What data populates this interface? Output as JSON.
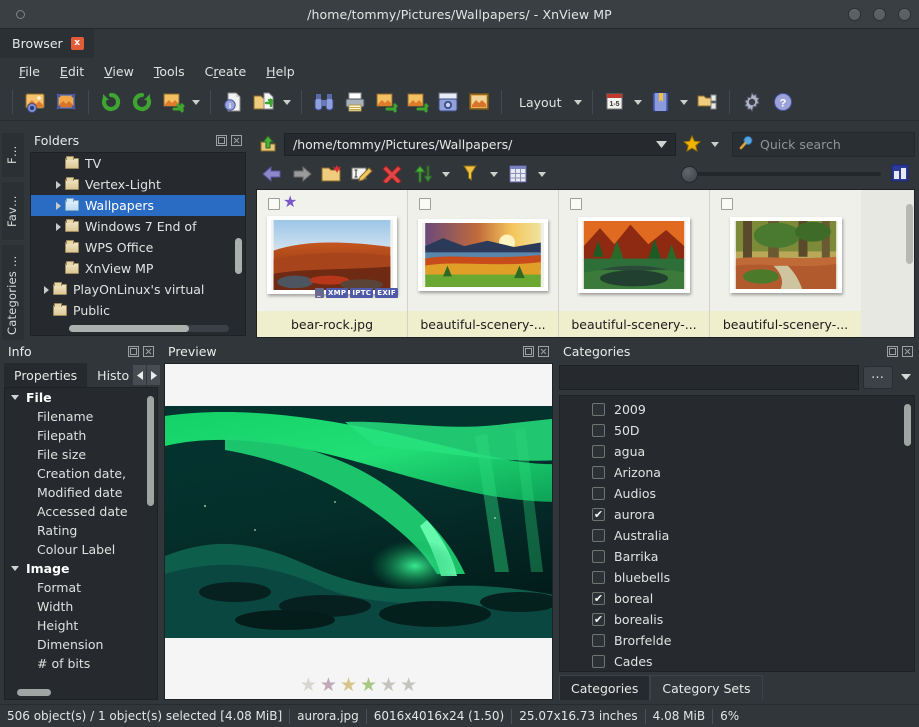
{
  "window": {
    "title": "/home/tommy/Pictures/Wallpapers/ - XnView MP",
    "controls": [
      "minimize",
      "maximize",
      "close"
    ]
  },
  "doc_tab": {
    "label": "Browser",
    "close_label": "x"
  },
  "menubar": [
    {
      "label": "File",
      "accel": "F"
    },
    {
      "label": "Edit",
      "accel": "E"
    },
    {
      "label": "View",
      "accel": "V"
    },
    {
      "label": "Tools",
      "accel": "T"
    },
    {
      "label": "Create",
      "accel": "r"
    },
    {
      "label": "Help",
      "accel": "H"
    }
  ],
  "toolbar": {
    "layout_label": "Layout",
    "buttons": [
      "open-image-icon",
      "fullscreen-icon",
      "rotate-left-icon",
      "rotate-right-icon",
      "convert-icon",
      "info-icon",
      "export-icon",
      "batch-rename-icon",
      "print-icon",
      "import-icon",
      "export-to-icon",
      "screen-capture-icon",
      "slideshow-icon",
      "numbered-pages-icon",
      "catalog-icon",
      "folder-compare-icon",
      "settings-gear-icon",
      "help-icon"
    ]
  },
  "browser": {
    "up_icon": "up-folder-icon",
    "address": "/home/tommy/Pictures/Wallpapers/",
    "favorites_icon": "star-icon",
    "search": {
      "placeholder": "Quick search",
      "icon": "search-icon",
      "value": ""
    },
    "subtoolbar": [
      "back-arrow-icon",
      "forward-arrow-icon",
      "new-folder-icon",
      "rename-icon",
      "delete-icon",
      "sort-icon",
      "filter-icon",
      "view-mode-icon"
    ],
    "zoom_slider_value": 0
  },
  "thumbnails": [
    {
      "filename": "bear-rock.jpg",
      "selected": true,
      "star": "★",
      "badges": [
        "XMP",
        "IPTC",
        "EXIF"
      ],
      "image_alt": "autumn-ridge-at-dusk"
    },
    {
      "filename": "beautiful-scenery-...",
      "selected": false,
      "star": "",
      "badges": [],
      "image_alt": "sunset-over-autumn-valley"
    },
    {
      "filename": "beautiful-scenery-...",
      "selected": false,
      "star": "",
      "badges": [],
      "image_alt": "red-forest-lake-reflection"
    },
    {
      "filename": "beautiful-scenery-...",
      "selected": false,
      "star": "",
      "badges": [],
      "image_alt": "mossy-forest-stream"
    }
  ],
  "folders": {
    "title": "Folders",
    "items": [
      {
        "label": "TV",
        "indent": 2,
        "expandable": false,
        "selected": false,
        "open": false
      },
      {
        "label": "Vertex-Light",
        "indent": 2,
        "expandable": true,
        "selected": false,
        "open": false
      },
      {
        "label": "Wallpapers",
        "indent": 2,
        "expandable": true,
        "selected": true,
        "open": true
      },
      {
        "label": "Windows 7 End of",
        "indent": 2,
        "expandable": true,
        "selected": false,
        "open": false
      },
      {
        "label": "WPS Office",
        "indent": 2,
        "expandable": false,
        "selected": false,
        "open": false
      },
      {
        "label": "XnView MP",
        "indent": 2,
        "expandable": false,
        "selected": false,
        "open": false
      },
      {
        "label": "PlayOnLinux's virtual",
        "indent": 1,
        "expandable": true,
        "selected": false,
        "open": false
      },
      {
        "label": "Public",
        "indent": 1,
        "expandable": false,
        "selected": false,
        "open": false
      }
    ]
  },
  "sidebar_tabs": [
    {
      "label": "F…"
    },
    {
      "label": "Fav…"
    },
    {
      "label": "Categories …"
    }
  ],
  "info": {
    "title": "Info",
    "tabs": [
      {
        "label": "Properties",
        "active": true
      },
      {
        "label": "Histo",
        "active": false
      }
    ],
    "properties": [
      {
        "label": "File",
        "group": true
      },
      {
        "label": "Filename",
        "group": false
      },
      {
        "label": "Filepath",
        "group": false
      },
      {
        "label": "File size",
        "group": false
      },
      {
        "label": "Creation date,",
        "group": false
      },
      {
        "label": "Modified date",
        "group": false
      },
      {
        "label": "Accessed date",
        "group": false
      },
      {
        "label": "Rating",
        "group": false
      },
      {
        "label": "Colour Label",
        "group": false
      },
      {
        "label": "Image",
        "group": true
      },
      {
        "label": "Format",
        "group": false
      },
      {
        "label": "Width",
        "group": false
      },
      {
        "label": "Height",
        "group": false
      },
      {
        "label": "Dimension",
        "group": false
      },
      {
        "label": "# of bits",
        "group": false
      }
    ]
  },
  "preview": {
    "title": "Preview",
    "image_alt": "aurora-borealis-over-snowy-hills",
    "rating_stars": [
      {
        "filled": false,
        "color": "#d7d7d0"
      },
      {
        "filled": true,
        "color": "#c0a8b6"
      },
      {
        "filled": true,
        "color": "#d6c48a"
      },
      {
        "filled": true,
        "color": "#a8c884"
      },
      {
        "filled": false,
        "color": "#c4c4bd"
      },
      {
        "filled": false,
        "color": "#c4c4bd"
      }
    ]
  },
  "categories": {
    "title": "Categories",
    "search_value": "",
    "more_button": "…",
    "items": [
      {
        "label": "2009",
        "checked": false
      },
      {
        "label": "50D",
        "checked": false
      },
      {
        "label": "agua",
        "checked": false
      },
      {
        "label": "Arizona",
        "checked": false
      },
      {
        "label": "Audios",
        "checked": false
      },
      {
        "label": "aurora",
        "checked": true
      },
      {
        "label": "Australia",
        "checked": false
      },
      {
        "label": "Barrika",
        "checked": false
      },
      {
        "label": "bluebells",
        "checked": false
      },
      {
        "label": "boreal",
        "checked": true
      },
      {
        "label": "borealis",
        "checked": true
      },
      {
        "label": "Brorfelde",
        "checked": false
      },
      {
        "label": "Cades",
        "checked": false
      }
    ],
    "tabs": [
      {
        "label": "Categories",
        "active": true
      },
      {
        "label": "Category Sets",
        "active": false
      }
    ]
  },
  "statusbar": {
    "objects": "506 object(s) / 1 object(s) selected [4.08 MiB]",
    "filename": "aurora.jpg",
    "dimensions": "6016x4016x24 (1.50)",
    "physical": "25.07x16.73 inches",
    "filesize": "4.08 MiB",
    "zoom": "6%"
  },
  "colors": {
    "panel_bg": "#31363b",
    "field_bg": "#262a2e",
    "selection_blue": "#2a6cc4",
    "thumb_bg": "#e8e8e2",
    "thumb_label_bg": "#efeecd",
    "accent_orange": "#e25c3a"
  }
}
